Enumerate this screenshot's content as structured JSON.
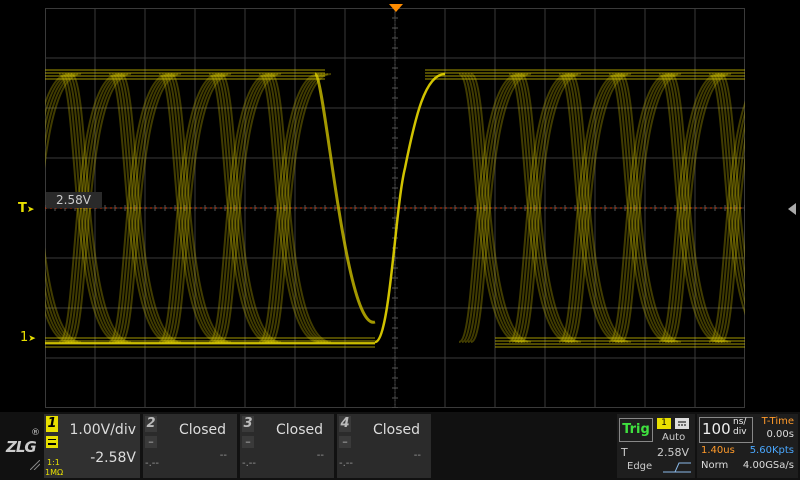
{
  "screen": {
    "trigger_marker": "T",
    "ch1_marker": "1",
    "trigger_level_label": "2.58V",
    "colors": {
      "trace": "#e8d800",
      "grid": "#3a3a3a",
      "background": "#000000",
      "trig_level_line": "#d03a10"
    }
  },
  "bottom": {
    "logo_text": "ZLG",
    "logo_reg": "®",
    "channels": [
      {
        "num": "1",
        "scale": "1.00V/div",
        "offset": "-2.58V",
        "coupling": "1:1",
        "impedance": "1MΩ",
        "active": true
      },
      {
        "num": "2",
        "status": "Closed",
        "dash_left": "-.--",
        "dash_right": "--"
      },
      {
        "num": "3",
        "status": "Closed",
        "dash_left": "-.--",
        "dash_right": "--"
      },
      {
        "num": "4",
        "status": "Closed",
        "dash_left": "-.--",
        "dash_right": "--"
      }
    ],
    "trigger": {
      "label": "Trig",
      "source": "1",
      "mode": "Auto",
      "level_name": "T",
      "level_value": "2.58V",
      "type": "Edge"
    },
    "timebase": {
      "value": "100",
      "unit_top": "ns/",
      "unit_bottom": "div",
      "position_label": "T-Time",
      "position_value": "0.00s",
      "window": "1.40us",
      "memory": "5.60Kpts",
      "acq_mode": "Norm",
      "sample_rate": "4.00GSa/s"
    }
  }
}
